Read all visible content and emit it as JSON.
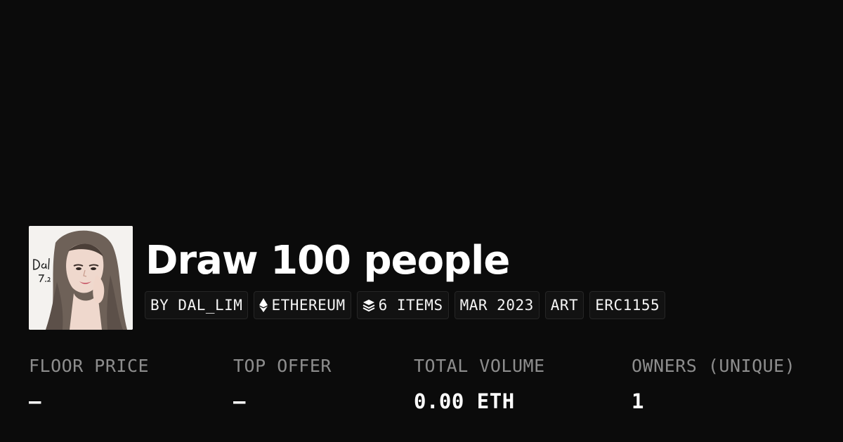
{
  "collection": {
    "title": "Draw 100 people",
    "avatar_signature": "Dal 7.2"
  },
  "chips": [
    {
      "label": "BY DAL_LIM",
      "icon": ""
    },
    {
      "label": "ETHEREUM",
      "icon": "ethereum-icon"
    },
    {
      "label": "6 ITEMS",
      "icon": "layers-icon"
    },
    {
      "label": "MAR 2023",
      "icon": ""
    },
    {
      "label": "ART",
      "icon": ""
    },
    {
      "label": "ERC1155",
      "icon": ""
    }
  ],
  "stats": [
    {
      "label": "FLOOR PRICE",
      "value": "–"
    },
    {
      "label": "TOP OFFER",
      "value": "–"
    },
    {
      "label": "TOTAL VOLUME",
      "value": "0.00 ETH"
    },
    {
      "label": "OWNERS (UNIQUE)",
      "value": "1"
    }
  ],
  "colors": {
    "background": "#0b0b0b",
    "text": "#ffffff",
    "muted": "#8d8d8d",
    "chip_border": "#262626"
  }
}
